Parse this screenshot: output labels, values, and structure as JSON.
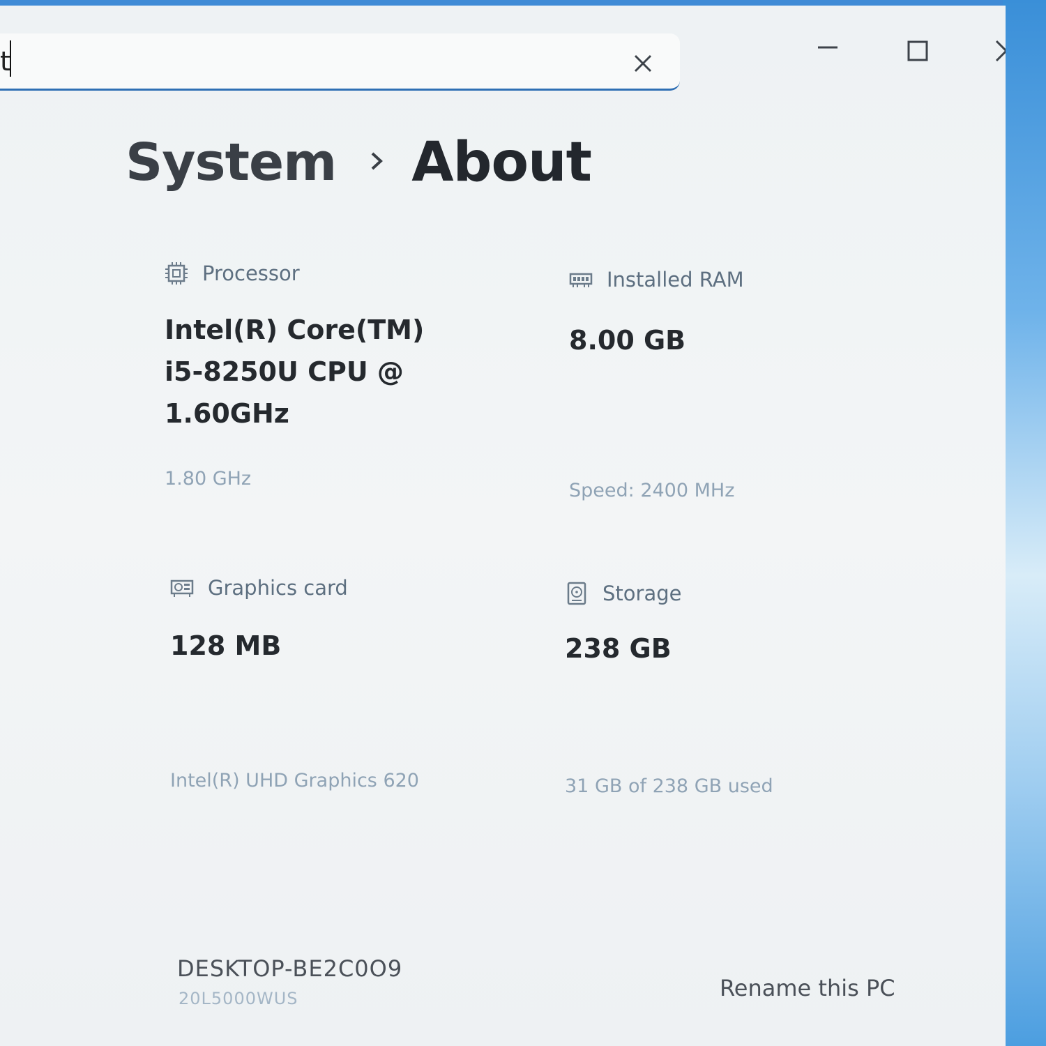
{
  "search": {
    "value": "t",
    "clear_icon": "close-icon"
  },
  "window_controls": {
    "minimize_icon": "minimize-icon",
    "maximize_icon": "maximize-icon",
    "close_icon": "close-icon"
  },
  "breadcrumb": {
    "parent": "System",
    "separator_icon": "chevron-right-icon",
    "current": "About"
  },
  "specs": {
    "processor": {
      "label": "Processor",
      "icon": "processor-icon",
      "value_lines": [
        "Intel(R) Core(TM)",
        "i5-8250U CPU @",
        "1.60GHz"
      ],
      "sub": "1.80 GHz"
    },
    "ram": {
      "label": "Installed RAM",
      "icon": "ram-icon",
      "value": "8.00 GB",
      "sub": "Speed: 2400 MHz"
    },
    "graphics": {
      "label": "Graphics card",
      "icon": "graphics-card-icon",
      "value": "128 MB",
      "sub": "Intel(R) UHD Graphics 620"
    },
    "storage": {
      "label": "Storage",
      "icon": "storage-icon",
      "value": "238 GB",
      "sub": "31 GB of 238 GB used"
    }
  },
  "device": {
    "name": "DESKTOP-BE2C0O9",
    "model": "20L5000WUS",
    "rename_label": "Rename this PC"
  },
  "colors": {
    "accent": "#2f6fb4",
    "wallpaper": "#3a8fd8"
  }
}
